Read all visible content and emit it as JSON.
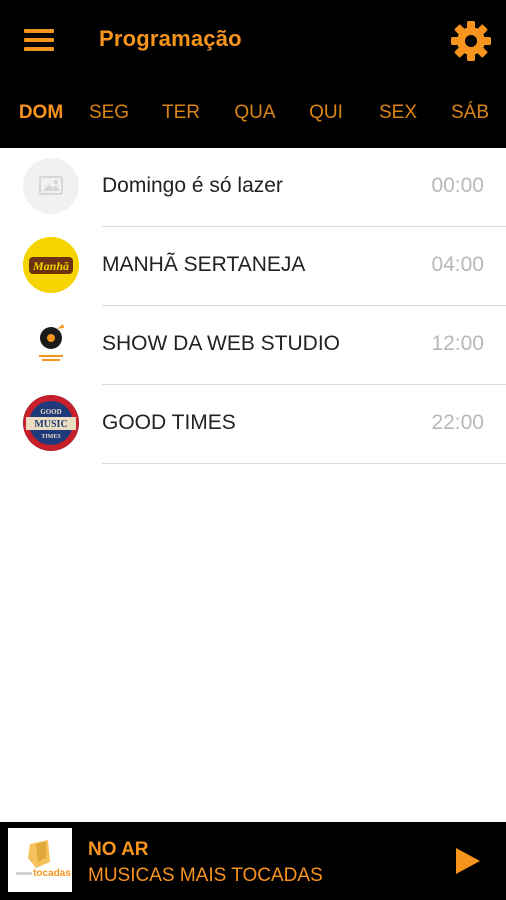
{
  "header": {
    "title": "Programação",
    "menu_icon": "menu-icon",
    "settings_icon": "gear-icon"
  },
  "tabs": [
    {
      "label": "DOM",
      "active": true
    },
    {
      "label": "SEG",
      "active": false
    },
    {
      "label": "TER",
      "active": false
    },
    {
      "label": "QUA",
      "active": false
    },
    {
      "label": "QUI",
      "active": false
    },
    {
      "label": "SEX",
      "active": false
    },
    {
      "label": "SÁB",
      "active": false
    }
  ],
  "programs": [
    {
      "name": "Domingo é só lazer",
      "time": "00:00",
      "thumb": "image-placeholder-icon"
    },
    {
      "name": "MANHÃ SERTANEJA",
      "time": "04:00",
      "thumb": "manha-sertaneja-logo",
      "logo_text": "Manhã"
    },
    {
      "name": "SHOW DA WEB STUDIO",
      "time": "12:00",
      "thumb": "web-studio-logo"
    },
    {
      "name": "GOOD TIMES",
      "time": "22:00",
      "thumb": "good-music-times-logo",
      "logo_text": [
        "GOOD",
        "MUSIC",
        "TIMES"
      ]
    }
  ],
  "player": {
    "status": "NO AR",
    "title": "MUSICAS MAIS TOCADAS",
    "logo": "musicas-mais-tocadas-logo",
    "logo_text": "tocadas",
    "play_icon": "play-icon"
  },
  "colors": {
    "accent": "#f7941d",
    "bar_background": "#000000",
    "time_text": "#b8b8b8",
    "divider": "#dcdcdc"
  }
}
